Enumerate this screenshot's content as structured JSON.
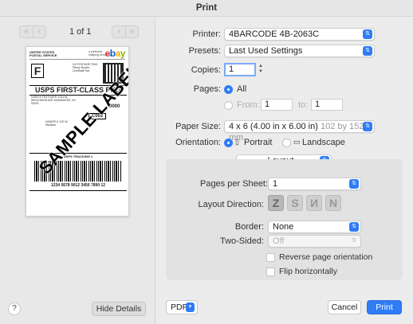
{
  "window": {
    "title": "Print"
  },
  "preview_nav": {
    "first_icon": "«",
    "prev_icon": "‹",
    "next_icon": "›",
    "last_icon": "»",
    "page_indicator": "1 of 1"
  },
  "label_preview": {
    "usps_logo": "UNITED STATES POSTAL SERVICE",
    "shipping_text": "a preferred shipping service on",
    "ebay": [
      "e",
      "b",
      "a",
      "y"
    ],
    "class_letter": "F",
    "postage_text": "US POSTAGE PAID Pitney Bowes ComBasPrice",
    "service_title": "USPS FIRST-CLASS PKG",
    "from_line": "USER A TESTUSER 1234 W. WISCONSIN AVE MILWAUKEE, WI 53201",
    "zone": "0000",
    "sort_code": "C002",
    "ship_to": "HANDPLE 100 W. Madison",
    "tracking_heading": "USPS TRACKING #",
    "tracking_number": "1234 5678 9012 3456 7890 12",
    "watermark": "SAMPLE LABEL"
  },
  "left_footer": {
    "help_label": "?",
    "hide_details_label": "Hide Details"
  },
  "form": {
    "printer_label": "Printer:",
    "printer_value": "4BARCODE 4B-2063C",
    "presets_label": "Presets:",
    "presets_value": "Last Used Settings",
    "copies_label": "Copies:",
    "copies_value": "1",
    "pages_label": "Pages:",
    "pages_all": "All",
    "pages_from": "From:",
    "pages_from_value": "1",
    "pages_to": "to:",
    "pages_to_value": "1",
    "paper_size_label": "Paper Size:",
    "paper_size_value": "4 x 6 (4.00 in x 6.00 in)",
    "paper_size_metric": "102 by 152 mm",
    "orientation_label": "Orientation:",
    "orientation_portrait": "Portrait",
    "orientation_landscape": "Landscape",
    "section_value": "Layout"
  },
  "layout": {
    "pages_per_sheet_label": "Pages per Sheet:",
    "pages_per_sheet_value": "1",
    "layout_direction_label": "Layout Direction:",
    "directions": [
      "Z",
      "S",
      "N",
      "N"
    ],
    "border_label": "Border:",
    "border_value": "None",
    "two_sided_label": "Two-Sided:",
    "two_sided_value": "Off",
    "reverse_label": "Reverse page orientation",
    "flip_label": "Flip horizontally"
  },
  "footer": {
    "pdf_label": "PDF",
    "cancel_label": "Cancel",
    "print_label": "Print"
  },
  "colors": {
    "accent": "#2f7cf6"
  },
  "icons": {
    "chevron": "chevron-updown-icon",
    "portrait": "portrait-orientation-icon",
    "landscape": "landscape-orientation-icon"
  }
}
